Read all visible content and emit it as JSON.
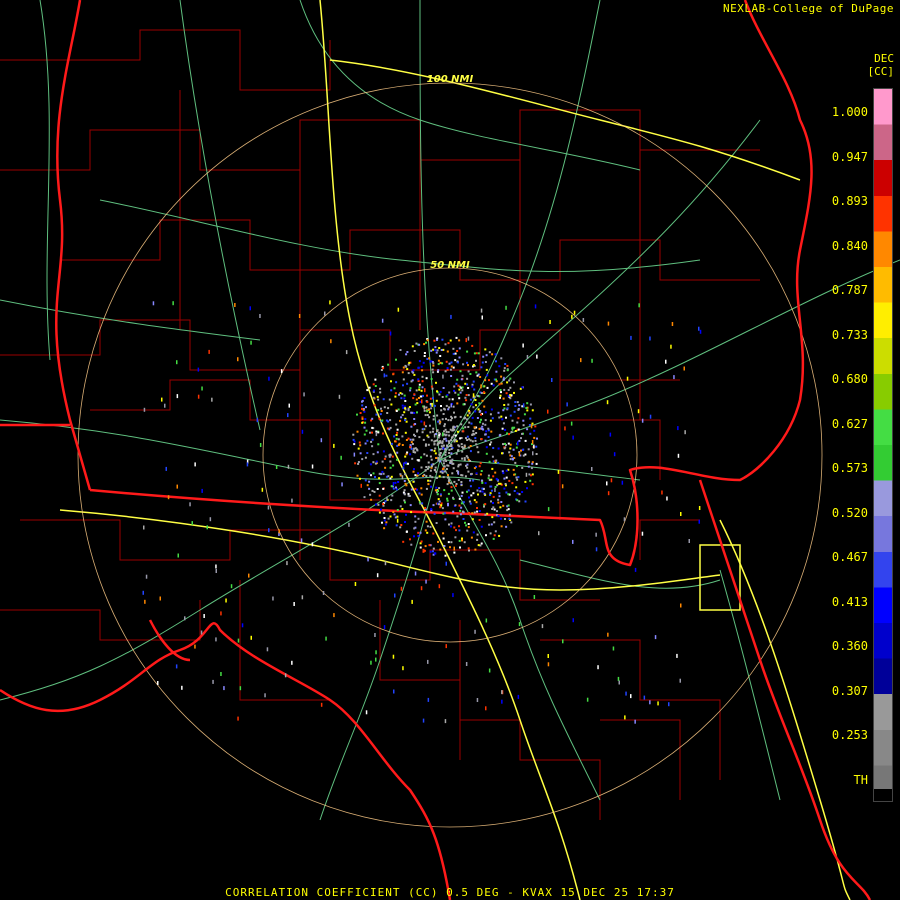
{
  "header": {
    "credit": "NEXLAB-College of DuPage"
  },
  "legend": {
    "unit_line1": "DEC",
    "unit_line2": "[CC]",
    "ticks": [
      "1.000",
      "0.947",
      "0.893",
      "0.840",
      "0.787",
      "0.733",
      "0.680",
      "0.627",
      "0.573",
      "0.520",
      "0.467",
      "0.413",
      "0.360",
      "0.307",
      "0.253",
      "TH"
    ],
    "colors": [
      "#ff99cc",
      "#cc6688",
      "#cc0000",
      "#ff3300",
      "#ff8800",
      "#ffbb00",
      "#ffee00",
      "#ccdd00",
      "#88cc00",
      "#44dd44",
      "#33cc33",
      "#9999dd",
      "#7777dd",
      "#3344ee",
      "#0000ff",
      "#0000cc",
      "#000099",
      "#999999",
      "#888888",
      "#777777"
    ]
  },
  "rings": {
    "inner_label": "50 NMI",
    "outer_label": "100 NMI"
  },
  "colors": {
    "state_border": "#ff1a1a",
    "county_border": "#aa0000",
    "roads": "#66cc88",
    "interstates": "#ffff44",
    "range_rings": "#ffcc88",
    "text": "#ffff00"
  },
  "footer": {
    "product": "CORRELATION COEFFICIENT (CC) 0.5 DEG - KVAX 15 DEC 25 17:37"
  }
}
